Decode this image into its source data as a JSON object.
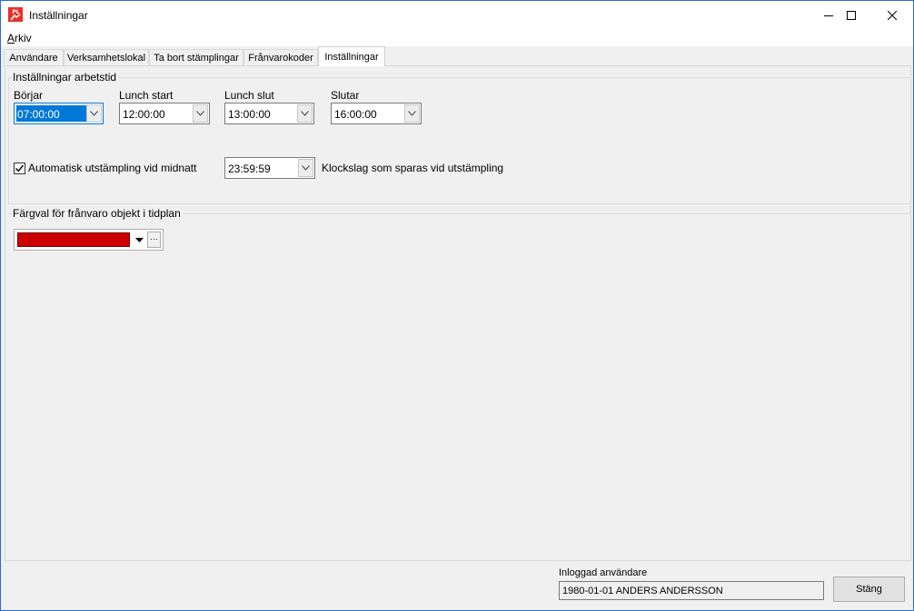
{
  "window": {
    "title": "Inställningar",
    "minimize_icon": "minimize-icon",
    "maximize_icon": "maximize-icon",
    "close_icon": "close-icon"
  },
  "menu": {
    "arkiv_u": "A",
    "arkiv_rest": "rkiv"
  },
  "tabs": [
    {
      "label": "Användare"
    },
    {
      "label": "Verksamhetslokal"
    },
    {
      "label": "Ta bort stämplingar"
    },
    {
      "label": "Frånvarokoder"
    },
    {
      "label": "Inställningar",
      "active": true
    }
  ],
  "worktime": {
    "title": "Inställningar arbetstid",
    "start_label": "Börjar",
    "start_value": "07:00:00",
    "lunch_start_label": "Lunch start",
    "lunch_start_value": "12:00:00",
    "lunch_end_label": "Lunch slut",
    "lunch_end_value": "13:00:00",
    "end_label": "Slutar",
    "end_value": "16:00:00",
    "auto_stamp_label": "Automatisk utstämpling vid midnatt",
    "auto_stamp_checked": true,
    "auto_stamp_time": "23:59:59",
    "auto_stamp_hint": "Klockslag som sparas vid utstämpling"
  },
  "absence_color": {
    "title": "Färgval för frånvaro objekt i tidplan",
    "color": "#cc0000",
    "more_label": "···"
  },
  "status": {
    "user_label": "Inloggad användare",
    "user_value": "1980-01-01  ANDERS ANDERSSON",
    "close_button_label": "Stäng"
  }
}
